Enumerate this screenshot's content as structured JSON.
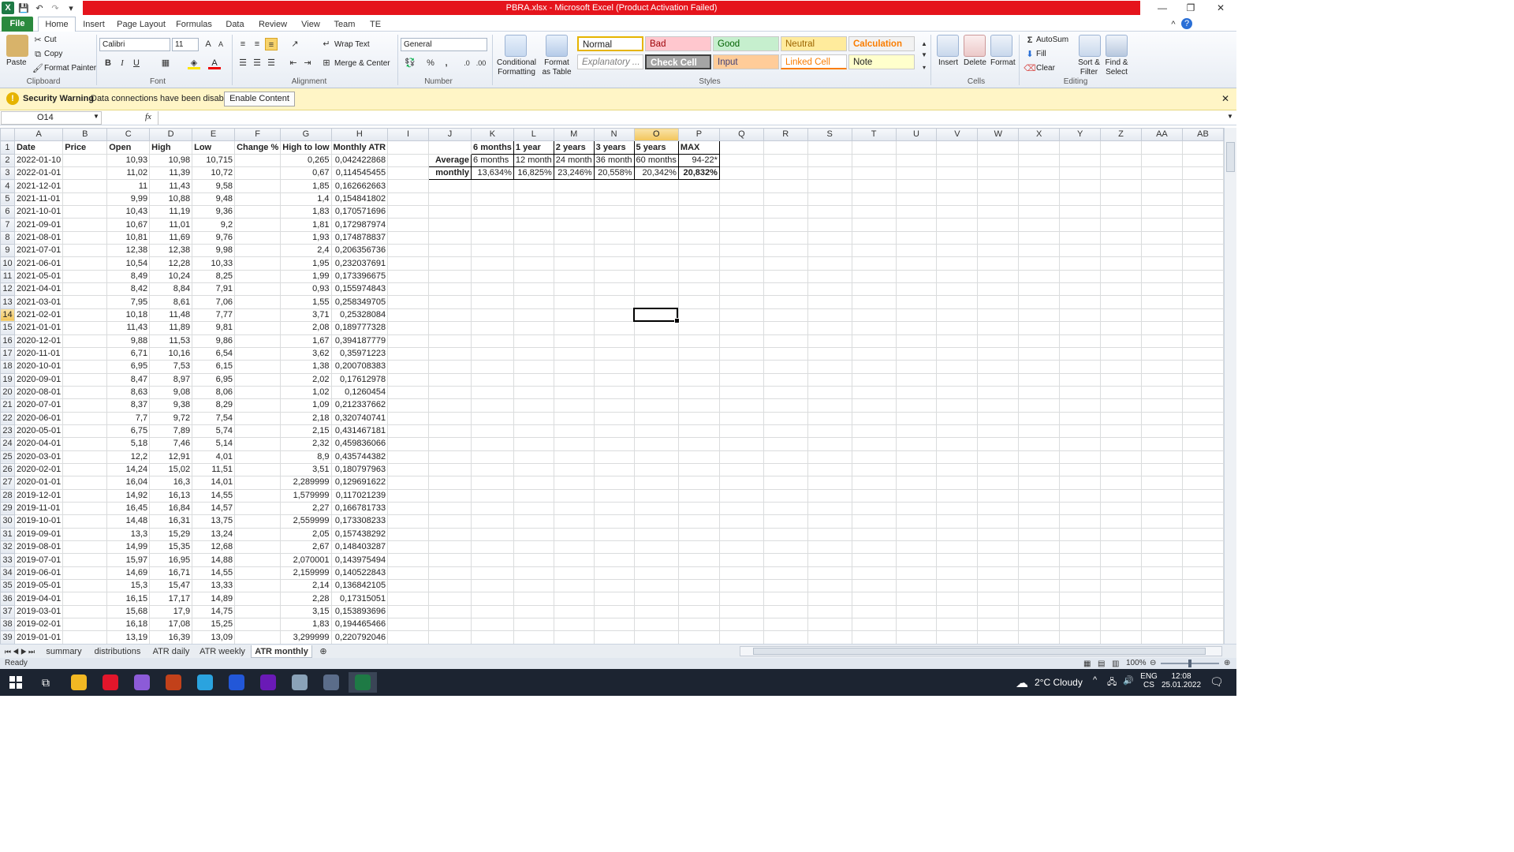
{
  "window": {
    "title": "PBRA.xlsx  -  Microsoft Excel (Product Activation Failed)",
    "minimize": "—",
    "restore": "❐",
    "close": "✕"
  },
  "ribbon_tabs": [
    "File",
    "Home",
    "Insert",
    "Page Layout",
    "Formulas",
    "Data",
    "Review",
    "View",
    "Team",
    "TE"
  ],
  "ribbon": {
    "clipboard": {
      "paste": "Paste",
      "cut": "Cut",
      "copy": "Copy",
      "format_painter": "Format Painter",
      "label": "Clipboard"
    },
    "font": {
      "name": "Calibri",
      "size": "11",
      "label": "Font",
      "bold": "B",
      "italic": "I",
      "underline": "U"
    },
    "alignment": {
      "wrap": "Wrap Text",
      "merge": "Merge & Center",
      "label": "Alignment"
    },
    "number": {
      "format": "General",
      "percent": "%",
      "comma": ",",
      "label": "Number"
    },
    "styles": {
      "conditional": "Conditional Formatting",
      "format_table": "Format as Table",
      "label": "Styles",
      "cells": [
        {
          "name": "Normal",
          "bg": "#ffffff",
          "fg": "#222222"
        },
        {
          "name": "Bad",
          "bg": "#ffc7ce",
          "fg": "#9c0006"
        },
        {
          "name": "Good",
          "bg": "#c6efce",
          "fg": "#006100"
        },
        {
          "name": "Neutral",
          "bg": "#ffeb9c",
          "fg": "#9c6500"
        },
        {
          "name": "Calculation",
          "bg": "#f2f2f2",
          "fg": "#fa7d00"
        },
        {
          "name": "Explanatory ...",
          "bg": "#ffffff",
          "fg": "#7f7f7f"
        },
        {
          "name": "Check Cell",
          "bg": "#a5a5a5",
          "fg": "#ffffff"
        },
        {
          "name": "Input",
          "bg": "#ffcc99",
          "fg": "#3f3f76"
        },
        {
          "name": "Linked Cell",
          "bg": "#ffffff",
          "fg": "#fa7d00"
        },
        {
          "name": "Note",
          "bg": "#ffffcc",
          "fg": "#222222"
        }
      ]
    },
    "cells": {
      "insert": "Insert",
      "delete": "Delete",
      "format": "Format",
      "label": "Cells"
    },
    "editing": {
      "autosum": "AutoSum",
      "fill": "Fill",
      "clear": "Clear",
      "sort": "Sort & Filter",
      "find": "Find & Select",
      "label": "Editing"
    }
  },
  "security": {
    "title": "Security Warning",
    "message": "Data connections have been disabled",
    "button": "Enable Content"
  },
  "formula_bar": {
    "name_box": "O14",
    "fx": "fx",
    "value": ""
  },
  "columns": [
    "A",
    "B",
    "C",
    "D",
    "E",
    "F",
    "G",
    "H",
    "I",
    "J",
    "K",
    "L",
    "M",
    "N",
    "O",
    "P",
    "Q",
    "R",
    "S",
    "T",
    "U",
    "V",
    "W",
    "X",
    "Y",
    "Z",
    "AA",
    "AB"
  ],
  "active": {
    "col": "O",
    "row": 14
  },
  "rows": [
    [
      "Date",
      "Price",
      "Open",
      "High",
      "Low",
      "Change %",
      "High to low",
      "Monthly ATR",
      "",
      "",
      "6 months",
      "1 year",
      "2 years",
      "3 years",
      "5 years",
      "MAX"
    ],
    [
      "2022-01-10",
      "",
      "10,93",
      "10,98",
      "10,715",
      "",
      "0,265",
      "0,042422868",
      "",
      "Average",
      "6 months",
      "12 month",
      "24 month",
      "36 month",
      "60 months",
      "94-22*"
    ],
    [
      "2022-01-01",
      "",
      "11,02",
      "11,39",
      "10,72",
      "",
      "0,67",
      "0,114545455",
      "",
      "monthly",
      "13,634%",
      "16,825%",
      "23,246%",
      "20,558%",
      "20,342%",
      "20,832%"
    ],
    [
      "2021-12-01",
      "",
      "11",
      "11,43",
      "9,58",
      "",
      "1,85",
      "0,162662663"
    ],
    [
      "2021-11-01",
      "",
      "9,99",
      "10,88",
      "9,48",
      "",
      "1,4",
      "0,154841802"
    ],
    [
      "2021-10-01",
      "",
      "10,43",
      "11,19",
      "9,36",
      "",
      "1,83",
      "0,170571696"
    ],
    [
      "2021-09-01",
      "",
      "10,67",
      "11,01",
      "9,2",
      "",
      "1,81",
      "0,172987974"
    ],
    [
      "2021-08-01",
      "",
      "10,81",
      "11,69",
      "9,76",
      "",
      "1,93",
      "0,174878837"
    ],
    [
      "2021-07-01",
      "",
      "12,38",
      "12,38",
      "9,98",
      "",
      "2,4",
      "0,206356736"
    ],
    [
      "2021-06-01",
      "",
      "10,54",
      "12,28",
      "10,33",
      "",
      "1,95",
      "0,232037691"
    ],
    [
      "2021-05-01",
      "",
      "8,49",
      "10,24",
      "8,25",
      "",
      "1,99",
      "0,173396675"
    ],
    [
      "2021-04-01",
      "",
      "8,42",
      "8,84",
      "7,91",
      "",
      "0,93",
      "0,155974843"
    ],
    [
      "2021-03-01",
      "",
      "7,95",
      "8,61",
      "7,06",
      "",
      "1,55",
      "0,258349705"
    ],
    [
      "2021-02-01",
      "",
      "10,18",
      "11,48",
      "7,77",
      "",
      "3,71",
      "0,25328084"
    ],
    [
      "2021-01-01",
      "",
      "11,43",
      "11,89",
      "9,81",
      "",
      "2,08",
      "0,189777328"
    ],
    [
      "2020-12-01",
      "",
      "9,88",
      "11,53",
      "9,86",
      "",
      "1,67",
      "0,394187779"
    ],
    [
      "2020-11-01",
      "",
      "6,71",
      "10,16",
      "6,54",
      "",
      "3,62",
      "0,35971223"
    ],
    [
      "2020-10-01",
      "",
      "6,95",
      "7,53",
      "6,15",
      "",
      "1,38",
      "0,200708383"
    ],
    [
      "2020-09-01",
      "",
      "8,47",
      "8,97",
      "6,95",
      "",
      "2,02",
      "0,17612978"
    ],
    [
      "2020-08-01",
      "",
      "8,63",
      "9,08",
      "8,06",
      "",
      "1,02",
      "0,1260454"
    ],
    [
      "2020-07-01",
      "",
      "8,37",
      "9,38",
      "8,29",
      "",
      "1,09",
      "0,212337662"
    ],
    [
      "2020-06-01",
      "",
      "7,7",
      "9,72",
      "7,54",
      "",
      "2,18",
      "0,320740741"
    ],
    [
      "2020-05-01",
      "",
      "6,75",
      "7,89",
      "5,74",
      "",
      "2,15",
      "0,431467181"
    ],
    [
      "2020-04-01",
      "",
      "5,18",
      "7,46",
      "5,14",
      "",
      "2,32",
      "0,459836066"
    ],
    [
      "2020-03-01",
      "",
      "12,2",
      "12,91",
      "4,01",
      "",
      "8,9",
      "0,435744382"
    ],
    [
      "2020-02-01",
      "",
      "14,24",
      "15,02",
      "11,51",
      "",
      "3,51",
      "0,180797963"
    ],
    [
      "2020-01-01",
      "",
      "16,04",
      "16,3",
      "14,01",
      "",
      "2,289999",
      "0,129691622"
    ],
    [
      "2019-12-01",
      "",
      "14,92",
      "16,13",
      "14,55",
      "",
      "1,579999",
      "0,117021239"
    ],
    [
      "2019-11-01",
      "",
      "16,45",
      "16,84",
      "14,57",
      "",
      "2,27",
      "0,166781733"
    ],
    [
      "2019-10-01",
      "",
      "14,48",
      "16,31",
      "13,75",
      "",
      "2,559999",
      "0,173308233"
    ],
    [
      "2019-09-01",
      "",
      "13,3",
      "15,29",
      "13,24",
      "",
      "2,05",
      "0,157438292"
    ],
    [
      "2019-08-01",
      "",
      "14,99",
      "15,35",
      "12,68",
      "",
      "2,67",
      "0,148403287"
    ],
    [
      "2019-07-01",
      "",
      "15,97",
      "16,95",
      "14,88",
      "",
      "2,070001",
      "0,143975494"
    ],
    [
      "2019-06-01",
      "",
      "14,69",
      "16,71",
      "14,55",
      "",
      "2,159999",
      "0,140522843"
    ],
    [
      "2019-05-01",
      "",
      "15,3",
      "15,47",
      "13,33",
      "",
      "2,14",
      "0,136842105"
    ],
    [
      "2019-04-01",
      "",
      "16,15",
      "17,17",
      "14,89",
      "",
      "2,28",
      "0,17315051"
    ],
    [
      "2019-03-01",
      "",
      "15,68",
      "17,9",
      "14,75",
      "",
      "3,15",
      "0,153893696"
    ],
    [
      "2019-02-01",
      "",
      "16,18",
      "17,08",
      "15,25",
      "",
      "1,83",
      "0,194465466"
    ],
    [
      "2019-01-01",
      "",
      "13,19",
      "16,39",
      "13,09",
      "",
      "3,299999",
      "0,220792046"
    ]
  ],
  "sheet_tabs": [
    "summary",
    "distributions",
    "ATR daily",
    "ATR weekly",
    "ATR monthly"
  ],
  "active_sheet": "ATR monthly",
  "status": {
    "ready": "Ready",
    "zoom": "100%"
  },
  "taskbar": {
    "weather": "2°C  Cloudy",
    "lang1": "ENG",
    "lang2": "CS",
    "time": "12:08",
    "date": "25.01.2022",
    "apps": [
      {
        "name": "explorer",
        "color": "#f2b823"
      },
      {
        "name": "opera",
        "color": "#e2162b"
      },
      {
        "name": "discord",
        "color": "#8c5bd8"
      },
      {
        "name": "sniper",
        "color": "#c2411a"
      },
      {
        "name": "telegram",
        "color": "#2aa3df"
      },
      {
        "name": "dots",
        "color": "#2257d8"
      },
      {
        "name": "video",
        "color": "#6a1ab6"
      },
      {
        "name": "app",
        "color": "#8aa2b8"
      },
      {
        "name": "calculator",
        "color": "#5b6d8a"
      },
      {
        "name": "excel",
        "color": "#1e7a45"
      }
    ]
  }
}
